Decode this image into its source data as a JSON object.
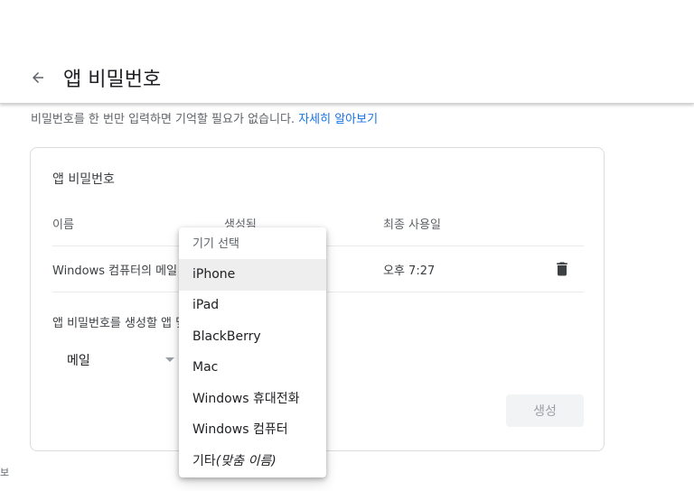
{
  "header": {
    "title": "앱 비밀번호"
  },
  "intro": {
    "text": "비밀번호를 한 번만 입력하면 기억할 필요가 없습니다.",
    "link": "자세히 알아보기"
  },
  "card": {
    "title": "앱 비밀번호",
    "columns": [
      "이름",
      "생성됨",
      "최종 사용일"
    ],
    "rows": [
      {
        "name": "Windows 컴퓨터의 메일",
        "last_used": "오후 7:27"
      }
    ],
    "generate_label": "앱 비밀번호를 생성할 앱 및 기기를 선택하세요.",
    "app_select": "메일",
    "generate_button": "생성"
  },
  "dropdown": {
    "header": "기기 선택",
    "items": [
      "iPhone",
      "iPad",
      "BlackBerry",
      "Mac",
      "Windows 휴대전화",
      "Windows 컴퓨터"
    ],
    "custom_prefix": "기타",
    "custom_suffix": "(맞춤 이름)",
    "selected_index": 0
  },
  "footer": {
    "fragment": "보"
  }
}
